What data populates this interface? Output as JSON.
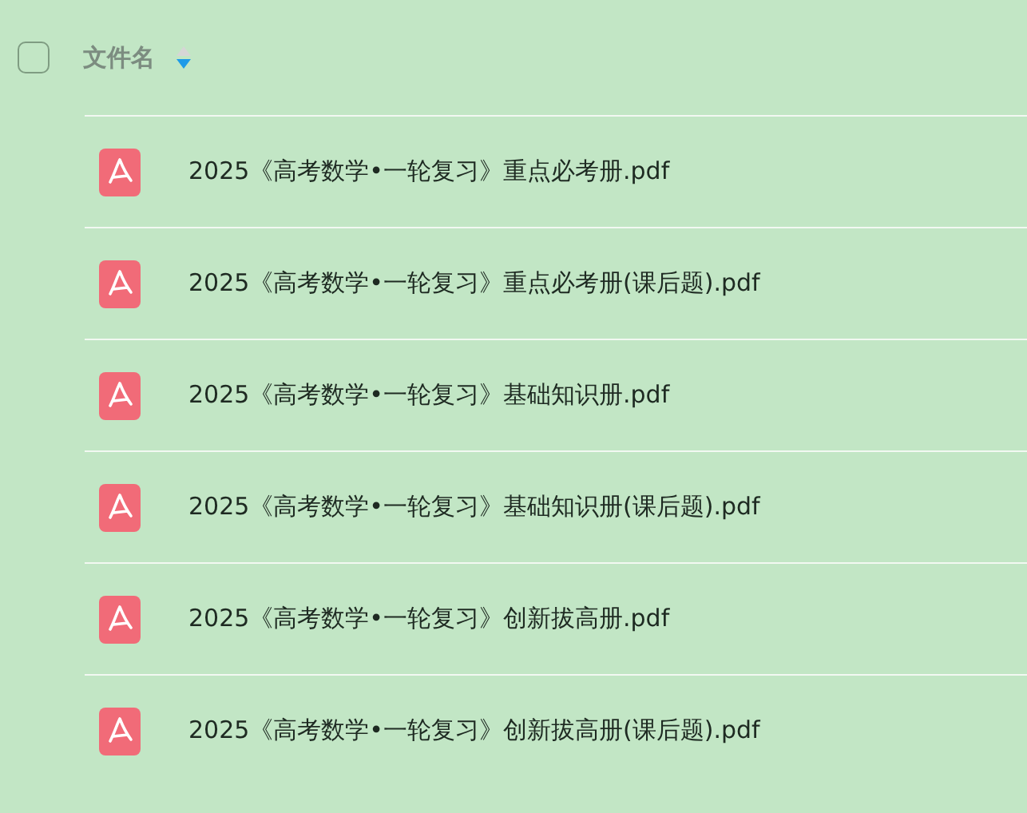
{
  "header": {
    "checked": false,
    "column": "文件名",
    "sorted_descending": true
  },
  "files": [
    {
      "name": "2025《高考数学•一轮复习》重点必考册.pdf",
      "kind": "pdf"
    },
    {
      "name": "2025《高考数学•一轮复习》重点必考册(课后题).pdf",
      "kind": "pdf"
    },
    {
      "name": "2025《高考数学•一轮复习》基础知识册.pdf",
      "kind": "pdf"
    },
    {
      "name": "2025《高考数学•一轮复习》基础知识册(课后题).pdf",
      "kind": "pdf"
    },
    {
      "name": "2025《高考数学•一轮复习》创新拔高册.pdf",
      "kind": "pdf"
    },
    {
      "name": "2025《高考数学•一轮复习》创新拔高册(课后题).pdf",
      "kind": "pdf"
    }
  ]
}
